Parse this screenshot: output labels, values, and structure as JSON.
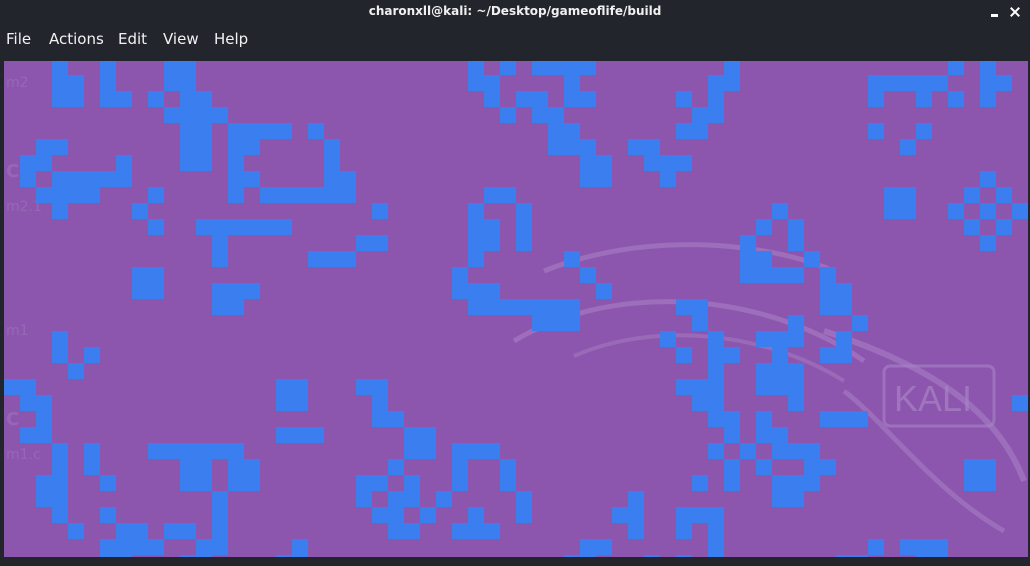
{
  "window": {
    "title": "charonxll@kali: ~/Desktop/gameoflife/build"
  },
  "menu": {
    "items": [
      "File",
      "Actions",
      "Edit",
      "View",
      "Help"
    ]
  },
  "terminal": {
    "background": "#8c56ae",
    "cell_color": "#3a7ef0",
    "watermark_text": "KALI",
    "ghost_labels": [
      "m2",
      "C",
      "m2.1",
      "m1",
      "C",
      "m1.c"
    ]
  }
}
